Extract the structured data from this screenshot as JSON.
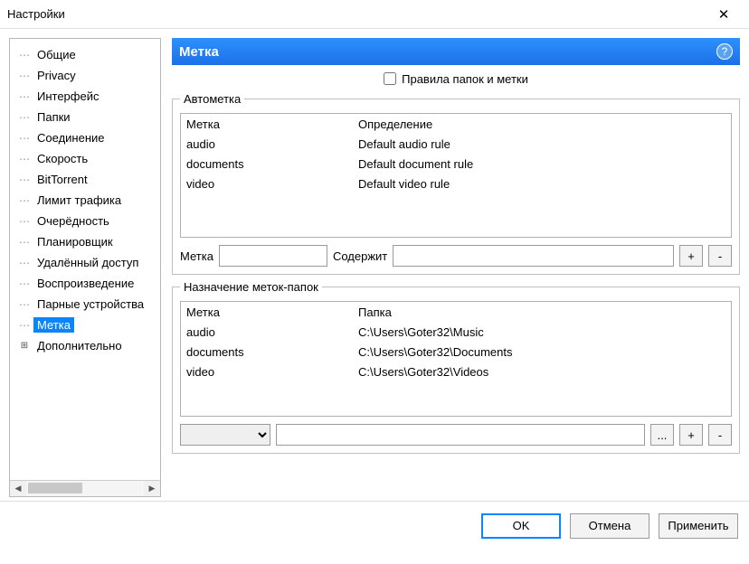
{
  "window": {
    "title": "Настройки"
  },
  "sidebar": {
    "items": [
      {
        "label": "Общие"
      },
      {
        "label": "Privacy"
      },
      {
        "label": "Интерфейс"
      },
      {
        "label": "Папки"
      },
      {
        "label": "Соединение"
      },
      {
        "label": "Скорость"
      },
      {
        "label": "BitTorrent"
      },
      {
        "label": "Лимит трафика"
      },
      {
        "label": "Очерёдность"
      },
      {
        "label": "Планировщик"
      },
      {
        "label": "Удалённый доступ"
      },
      {
        "label": "Воспроизведение"
      },
      {
        "label": "Парные устройства"
      },
      {
        "label": "Метка",
        "selected": true
      },
      {
        "label": "Дополнительно",
        "expandable": true
      }
    ]
  },
  "panel": {
    "title": "Метка",
    "checkbox_label": "Правила папок и метки",
    "autolabel": {
      "legend": "Автометка",
      "head": {
        "c1": "Метка",
        "c2": "Определение"
      },
      "rows": [
        {
          "c1": "audio",
          "c2": "Default audio rule"
        },
        {
          "c1": "documents",
          "c2": "Default document rule"
        },
        {
          "c1": "video",
          "c2": "Default video rule"
        }
      ],
      "edit": {
        "label1": "Метка",
        "label2": "Содержит",
        "plus": "+",
        "minus": "-"
      }
    },
    "assign": {
      "legend": "Назначение меток-папок",
      "head": {
        "c1": "Метка",
        "c2": "Папка"
      },
      "rows": [
        {
          "c1": "audio",
          "c2": "C:\\Users\\Goter32\\Music"
        },
        {
          "c1": "documents",
          "c2": "C:\\Users\\Goter32\\Documents"
        },
        {
          "c1": "video",
          "c2": "C:\\Users\\Goter32\\Videos"
        }
      ],
      "edit": {
        "browse": "...",
        "plus": "+",
        "minus": "-"
      }
    }
  },
  "buttons": {
    "ok": "OK",
    "cancel": "Отмена",
    "apply": "Применить"
  }
}
